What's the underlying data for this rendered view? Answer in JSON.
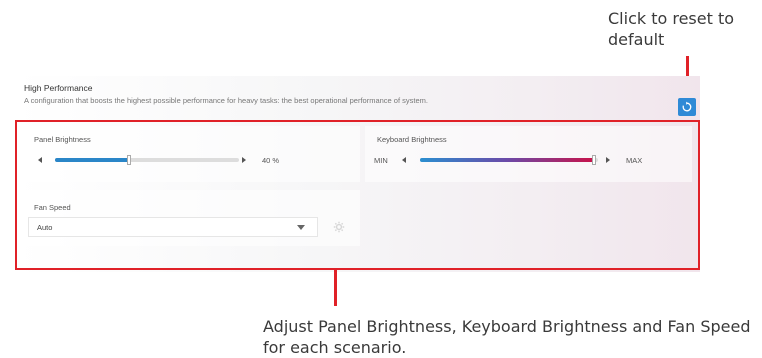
{
  "callouts": {
    "reset": "Click to reset to default",
    "adjust": "Adjust Panel Brightness, Keyboard Brightness and Fan Speed for each scenario."
  },
  "mode": {
    "title": "High Performance",
    "description": "A configuration that boosts the highest possible performance for heavy tasks: the best operational performance of system."
  },
  "reset_button": {
    "icon": "reset-icon"
  },
  "panel_brightness": {
    "label": "Panel Brightness",
    "value": 40,
    "value_text": "40 %"
  },
  "keyboard_brightness": {
    "label": "Keyboard Brightness",
    "min_label": "MIN",
    "max_label": "MAX",
    "value_fraction": 0.98
  },
  "fan_speed": {
    "label": "Fan Speed",
    "selected": "Auto",
    "settings_icon": "gear-icon"
  },
  "colors": {
    "accent": "#2f8ad6",
    "highlight": "#e02128",
    "keyboard_gradient_start": "#2a8fd0",
    "keyboard_gradient_end": "#c8124a"
  }
}
